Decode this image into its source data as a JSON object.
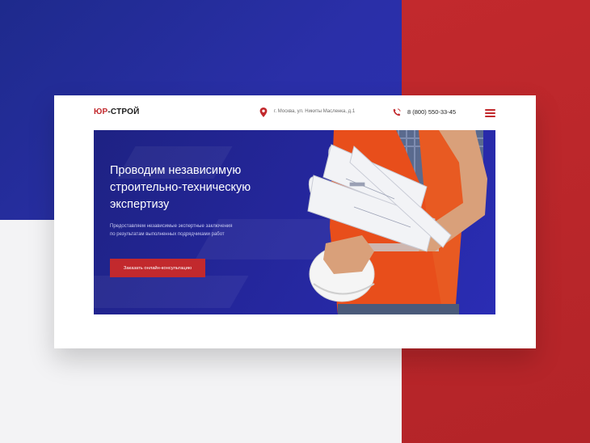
{
  "brand": {
    "logo_part1": "ЮР",
    "logo_part2": "-СТРОЙ"
  },
  "header": {
    "address": "г. Москва, ул. Никиты Масленка, д.1",
    "phone": "8 (800) 550-33-45"
  },
  "hero": {
    "title_line1": "Проводим независимую",
    "title_line2": "строительно-техническую",
    "title_line3": "экспертизу",
    "subtitle_line1": "Предоставляем независимые экспертные заключения",
    "subtitle_line2": "по  результатам выполненных подрядчиками работ",
    "cta_label": "Заказать онлайн-консультацию"
  },
  "colors": {
    "brand_red": "#c2292d",
    "brand_blue": "#24269a"
  }
}
